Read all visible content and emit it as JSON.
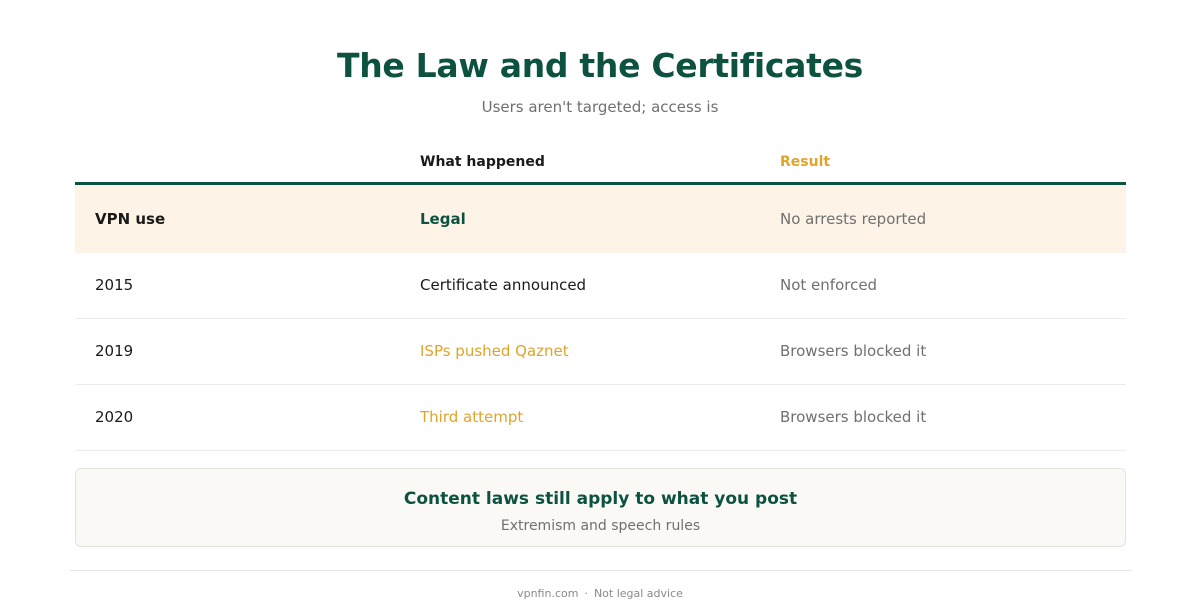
{
  "header": {
    "title": "The Law and the Certificates",
    "subtitle": "Users aren't targeted; access is"
  },
  "table": {
    "columns": [
      "",
      "What happened",
      "Result"
    ],
    "rows": [
      {
        "label": "VPN use",
        "event": "Legal",
        "result": "No arrests reported"
      },
      {
        "label": "2015",
        "event": "Certificate announced",
        "result": "Not enforced"
      },
      {
        "label": "2019",
        "event": "ISPs pushed Qaznet",
        "result": "Browsers blocked it"
      },
      {
        "label": "2020",
        "event": "Third attempt",
        "result": "Browsers blocked it"
      }
    ]
  },
  "callout": {
    "title": "Content laws still apply to what you post",
    "subtitle": "Extremism and speech rules"
  },
  "footer": {
    "site": "vpnfin.com",
    "separator": "·",
    "disclaimer": "Not legal advice"
  },
  "colors": {
    "primary_green": "#0d5240",
    "accent_amber": "#e0a42a",
    "highlight_row_bg": "#fdf3e7",
    "muted_text": "#707070"
  }
}
